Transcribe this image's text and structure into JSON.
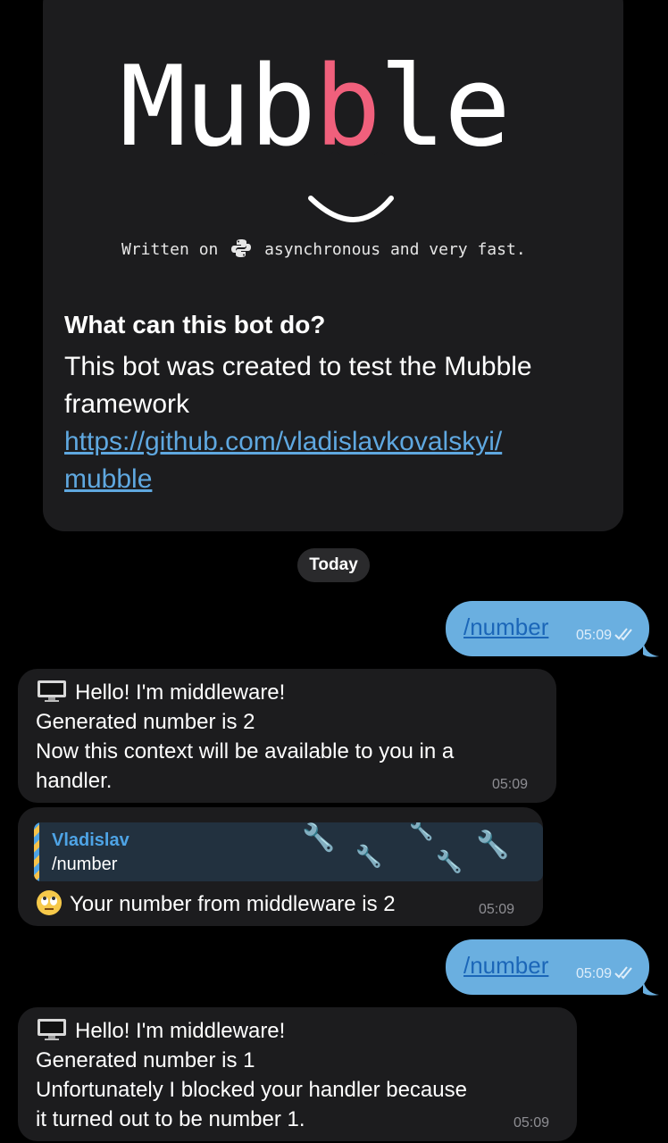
{
  "intro": {
    "logo_parts": [
      "Mu",
      "b",
      "b",
      "le"
    ],
    "tagline_prefix": "Written on",
    "tagline_suffix": "asynchronous and very fast.",
    "title": "What can this bot do?",
    "description": "This bot was created to test the Mubble framework",
    "link_line1": "https://github.com/vladislavkovalskyi/",
    "link_line2": "mubble"
  },
  "date_separator": "Today",
  "messages": [
    {
      "type": "outgoing",
      "text": "/number",
      "time": "05:09"
    },
    {
      "type": "incoming",
      "lines": [
        "Hello! I'm middleware!",
        "Generated number is 2",
        "Now this context will be available to you in a",
        "handler."
      ],
      "time": "05:09"
    },
    {
      "type": "incoming_reply",
      "reply_name": "Vladislav",
      "reply_text": "/number",
      "text": "Your number from middleware is 2",
      "time": "05:09"
    },
    {
      "type": "outgoing",
      "text": "/number",
      "time": "05:09"
    },
    {
      "type": "incoming",
      "lines": [
        "Hello! I'm middleware!",
        "Generated number is 1",
        "Unfortunately I blocked your handler because",
        "it turned out to be number 1."
      ],
      "time": "05:09"
    }
  ],
  "colors": {
    "outgoing_bubble": "#6aafe0",
    "incoming_bubble": "#1c1c1e",
    "link": "#5fa8e0",
    "accent_pink": "#f0607c"
  },
  "icons": [
    "python-logo-icon",
    "monitor-emoji-icon",
    "rolling-eyes-emoji-icon",
    "double-check-icon",
    "wrench-icon"
  ]
}
